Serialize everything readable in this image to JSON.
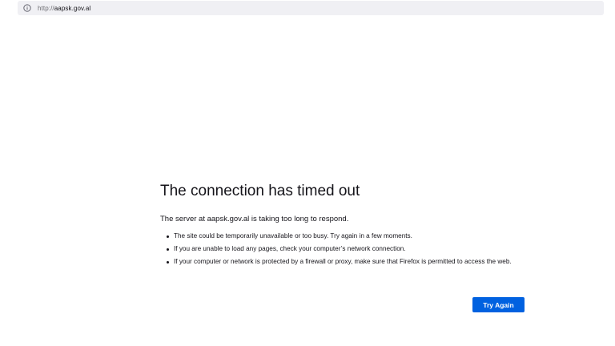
{
  "browser": {
    "url_scheme": "http://",
    "url_host": "aapsk.gov.al",
    "info_icon": "info-icon"
  },
  "error_page": {
    "title": "The connection has timed out",
    "description": "The server at aapsk.gov.al is taking too long to respond.",
    "reasons": [
      "The site could be temporarily unavailable or too busy. Try again in a few moments.",
      "If you are unable to load any pages, check your computer’s network connection.",
      "If your computer or network is protected by a firewall or proxy, make sure that Firefox is permitted to access the web."
    ],
    "try_again_label": "Try Again",
    "accent_color": "#0061e0"
  }
}
